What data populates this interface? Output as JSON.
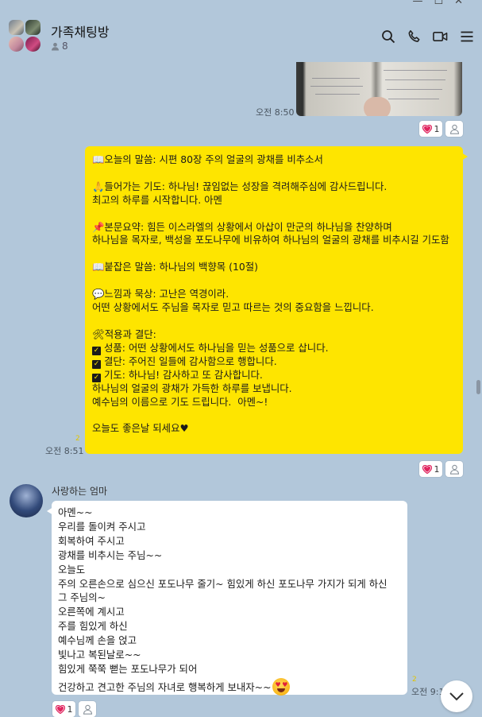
{
  "window": {
    "controls": [
      "—",
      "☐",
      "✕"
    ]
  },
  "header": {
    "title": "가족채팅방",
    "member_count": "8",
    "icons": [
      "search-icon",
      "phone-icon",
      "video-icon",
      "menu-icon"
    ]
  },
  "messages": {
    "photo_time": "오전 8:50",
    "photo_reactions": {
      "heart_count": "1"
    },
    "devotion": {
      "time": "오전 8:51",
      "read_count": "2",
      "reactions": {
        "heart_count": "1"
      },
      "lines": {
        "l1": "📖오늘의 말씀: 시편 80장 주의 얼굴의 광채를 비추소서",
        "l2": "🙏들어가는 기도: 하나님! 끊임없는 성장을 격려해주심에 감사드립니다.",
        "l3": "최고의 하루를 시작합니다. 아멘",
        "l4": "📌본문요약: 힘든 이스라엘의 상황에서 아삽이 만군의 하나님을 찬양하며",
        "l5": "하나님을 목자로, 백성을 포도나무에 비유하여 하나님의 얼굴의 광채를 비추시길 기도함",
        "l6": "📖붙잡은 말씀: 하나님의 백향목 (10절)",
        "l7": "💬느낌과 묵상: 고난은 역경이라.",
        "l8": "어떤 상황에서도 주님을 목자로 믿고 따르는 것의 중요함을 느낍니다.",
        "l9": "🛠적용과 결단:",
        "l10": "성품: 어떤 상황에서도 하나님을 믿는 성품으로 삽니다.",
        "l11": "결단: 주어진 일들에 감사함으로 행합니다.",
        "l12": "기도: 하나님! 감사하고 또 감사합니다.",
        "l13": "하나님의 얼굴의 광채가 가득한 하루를 보냅니다.",
        "l14": "예수님의 이름으로 기도 드립니다.  아멘~!",
        "l15": "오늘도 좋은날 되세요♥"
      }
    },
    "mom": {
      "sender": "사랑하는 엄마",
      "time": "오전 9:1",
      "read_count": "2",
      "reactions": {
        "heart_count": "1"
      },
      "lines": {
        "m1": "아멘~~",
        "m2": "우리를 돌이켜 주시고",
        "m3": "회복하여 주시고",
        "m4": "광채를 비추시는 주님~~",
        "m5": "오늘도",
        "m6": "주의 오른손으로 심으신 포도나무 줄기~ 힘있게 하신 포도나무 가지가 되게 하신",
        "m7": "그 주님의~",
        "m8": "오른쪽에 계시고",
        "m9": "주를 힘있게 하신",
        "m10": "예수님께 손을 얹고",
        "m11": "빛나고 복된날로~~",
        "m12": "힘있게 쭉쭉 뻗는 포도나무가 되어",
        "m13": "건강하고 견고한 주님의 자녀로 행복하게 보내자~~"
      }
    }
  }
}
